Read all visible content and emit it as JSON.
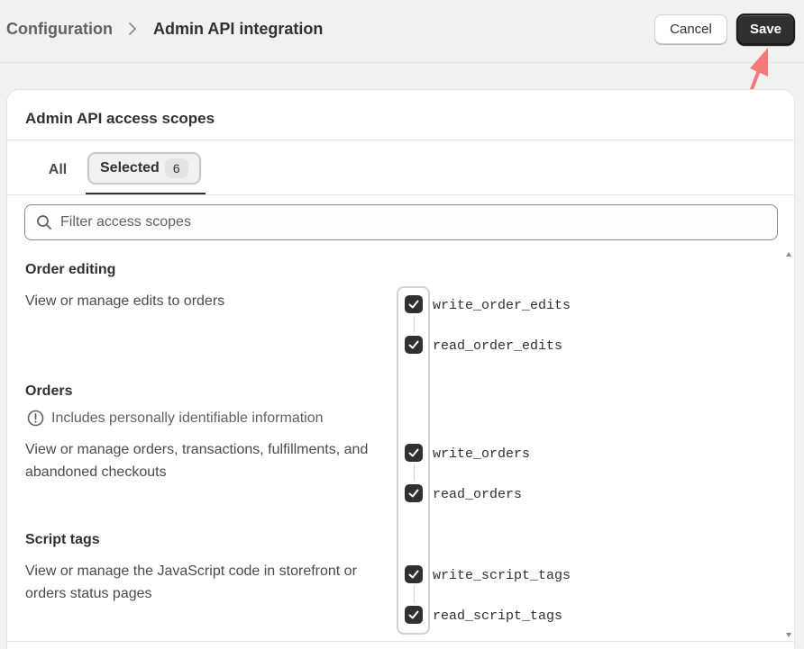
{
  "breadcrumb": {
    "parent": "Configuration",
    "current": "Admin API integration"
  },
  "actions": {
    "cancel": "Cancel",
    "save": "Save"
  },
  "card": {
    "title": "Admin API access scopes",
    "tabs": {
      "all": "All",
      "selected": "Selected",
      "selected_count": "6"
    },
    "search": {
      "placeholder": "Filter access scopes",
      "value": ""
    }
  },
  "sections": [
    {
      "title": "Order editing",
      "description": "View or manage edits to orders",
      "scopes": [
        {
          "name": "write_order_edits",
          "checked": true
        },
        {
          "name": "read_order_edits",
          "checked": true
        }
      ]
    },
    {
      "title": "Orders",
      "notice": "Includes personally identifiable information",
      "description": "View or manage orders, transactions, fulfillments, and abandoned checkouts",
      "scopes": [
        {
          "name": "write_orders",
          "checked": true
        },
        {
          "name": "read_orders",
          "checked": true
        }
      ]
    },
    {
      "title": "Script tags",
      "description": "View or manage the JavaScript code in storefront or orders status pages",
      "scopes": [
        {
          "name": "write_script_tags",
          "checked": true
        },
        {
          "name": "read_script_tags",
          "checked": true
        }
      ]
    }
  ],
  "colors": {
    "primary_button": "#303030",
    "annotation_arrow": "#f47a7a",
    "background": "#f1f1f1"
  },
  "icons": {
    "breadcrumb_separator": "chevron-right-icon",
    "search": "search-icon",
    "notice": "info-circle-icon",
    "checkbox": "checkmark-icon"
  }
}
